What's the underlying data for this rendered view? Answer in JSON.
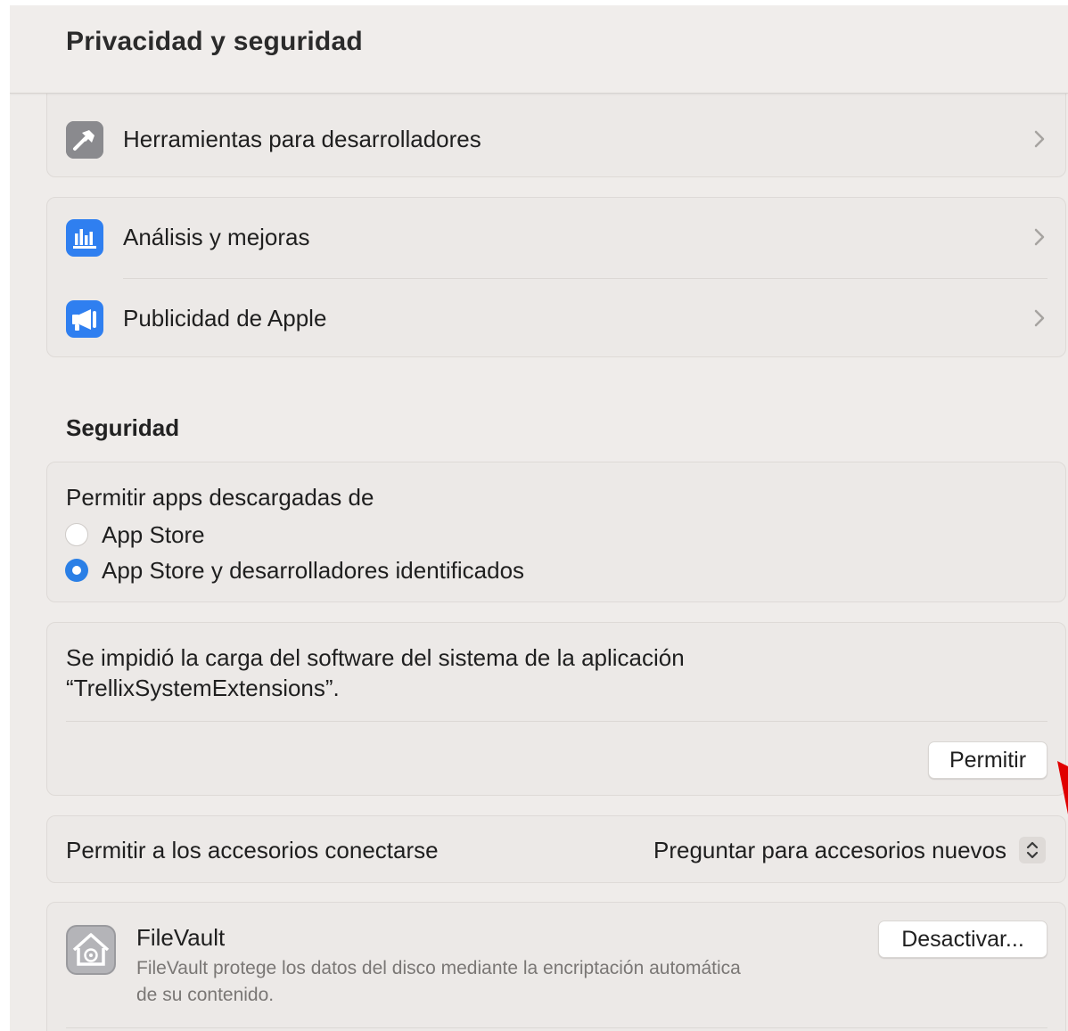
{
  "window": {
    "title": "Privacidad y seguridad"
  },
  "rows_top": [
    {
      "label": "Herramientas para desarrolladores",
      "icon": "hammer-icon"
    },
    {
      "label": "Análisis y mejoras",
      "icon": "bar-chart-icon"
    },
    {
      "label": "Publicidad de Apple",
      "icon": "megaphone-icon"
    }
  ],
  "security": {
    "heading": "Seguridad",
    "allow_apps_label": "Permitir apps descargadas de",
    "options": [
      {
        "label": "App Store",
        "selected": false
      },
      {
        "label": "App Store y desarrolladores identificados",
        "selected": true
      }
    ],
    "blocked_message_line1": "Se impidió la carga del software del sistema de la aplicación",
    "blocked_message_line2": "“TrellixSystemExtensions”.",
    "allow_button": "Permitir",
    "accessories_label": "Permitir a los accesorios conectarse",
    "accessories_value": "Preguntar para accesorios nuevos",
    "filevault": {
      "title": "FileVault",
      "description_line1": "FileVault protege los datos del disco mediante la encriptación automática",
      "description_line2": "de su contenido.",
      "button": "Desactivar...",
      "icon": "house-lock-icon"
    }
  },
  "colors": {
    "accent": "#2a7fe6",
    "annotation_arrow": "#e00000"
  }
}
